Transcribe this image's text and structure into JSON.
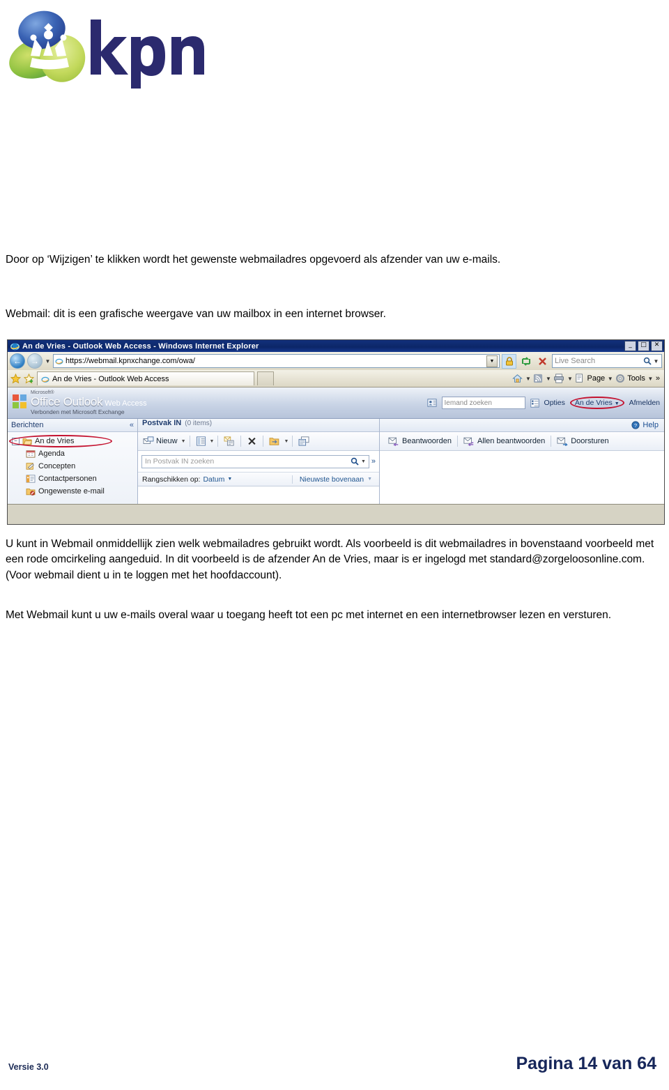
{
  "logo": {
    "brand": "kpn",
    "alt": "KPN logo with crown"
  },
  "document": {
    "paragraph1": "Door op ‘Wijzigen’ te klikken wordt het gewenste webmailadres opgevoerd als afzender van uw e-mails.",
    "paragraph2": "Webmail: dit is een grafische weergave van uw mailbox in een internet browser.",
    "paragraph3": "U kunt in Webmail onmiddellijk zien welk webmailadres gebruikt wordt. Als voorbeeld is dit webmailadres in bovenstaand voorbeeld met een rode omcirkeling aangeduid. In dit voorbeeld is de afzender An de Vries, maar is er ingelogd met standard@zorgeloosonline.com. (Voor webmail dient u in te loggen met het hoofdaccount).",
    "paragraph4": "Met Webmail kunt u uw e-mails overal waar u toegang heeft tot een pc met internet en een internetbrowser lezen en versturen."
  },
  "footer": {
    "version": "Versie 3.0",
    "page": "Pagina 14 van 64"
  },
  "browser": {
    "title": "An de Vries - Outlook Web Access - Windows Internet Explorer",
    "window_buttons": {
      "minimize": "_",
      "maximize": "□",
      "close": "✕"
    },
    "address": {
      "url": "https://webmail.kpnxchange.com/owa/",
      "dropdown": "▼"
    },
    "nav": {
      "back": "←",
      "forward": "→",
      "history_caret": "▼"
    },
    "buttons": {
      "lock": "lock-icon",
      "refresh": "refresh-icon",
      "stop": "stop-icon"
    },
    "search": {
      "placeholder": "Live Search",
      "go": "⌕",
      "caret": "▼"
    },
    "favorites": {
      "star": "favorites-star",
      "add": "add-to-favorites"
    },
    "tab": {
      "label": "An de Vries - Outlook Web Access"
    },
    "commandbar": {
      "home": "home-icon",
      "feeds": "rss-icon",
      "print": "print-icon",
      "page_label": "Page",
      "tools_label": "Tools",
      "overflow": "»",
      "caret": "▼"
    }
  },
  "owa": {
    "brand": {
      "microsoft": "Microsoft®",
      "product_part1": "Office Outlook",
      "product_part2": "Web Access",
      "subtitle": "Verbonden met Microsoft Exchange"
    },
    "header": {
      "find_someone_placeholder": "Iemand zoeken",
      "options": "Opties",
      "user": "An de Vries",
      "user_caret": "▼",
      "signout": "Afmelden",
      "highlight_color": "#c4122f"
    },
    "navpane": {
      "title": "Berichten",
      "collapse": "«",
      "tree": [
        {
          "label": "An de Vries",
          "expander": "−",
          "icon": "folder-open-icon",
          "highlighted": true
        },
        {
          "label": "Agenda",
          "icon": "calendar-icon"
        },
        {
          "label": "Concepten",
          "icon": "drafts-icon"
        },
        {
          "label": "Contactpersonen",
          "icon": "contacts-icon"
        },
        {
          "label": "Ongewenste e-mail",
          "icon": "junk-folder-icon"
        }
      ]
    },
    "list": {
      "folder": "Postvak IN",
      "count": "(0 items)",
      "toolbar": {
        "new_label": "Nieuw",
        "new_caret": "▼",
        "view_caret": "▼",
        "icons": [
          "new-mail-icon",
          "view-icon",
          "check-messages-icon",
          "delete-icon",
          "move-icon",
          "categorize-icon"
        ]
      },
      "search_placeholder": "In Postvak IN zoeken",
      "search_icon": "⌕",
      "search_caret": "▼",
      "expand_icon": "»",
      "sort": {
        "label": "Rangschikken op:",
        "value": "Datum",
        "caret": "▼",
        "order": "Nieuwste bovenaan",
        "order_caret": "▼"
      }
    },
    "reading": {
      "help": "Help",
      "actions": [
        {
          "label": "Beantwoorden",
          "icon": "reply-icon"
        },
        {
          "label": "Allen beantwoorden",
          "icon": "reply-all-icon"
        },
        {
          "label": "Doorsturen",
          "icon": "forward-icon"
        }
      ]
    }
  }
}
